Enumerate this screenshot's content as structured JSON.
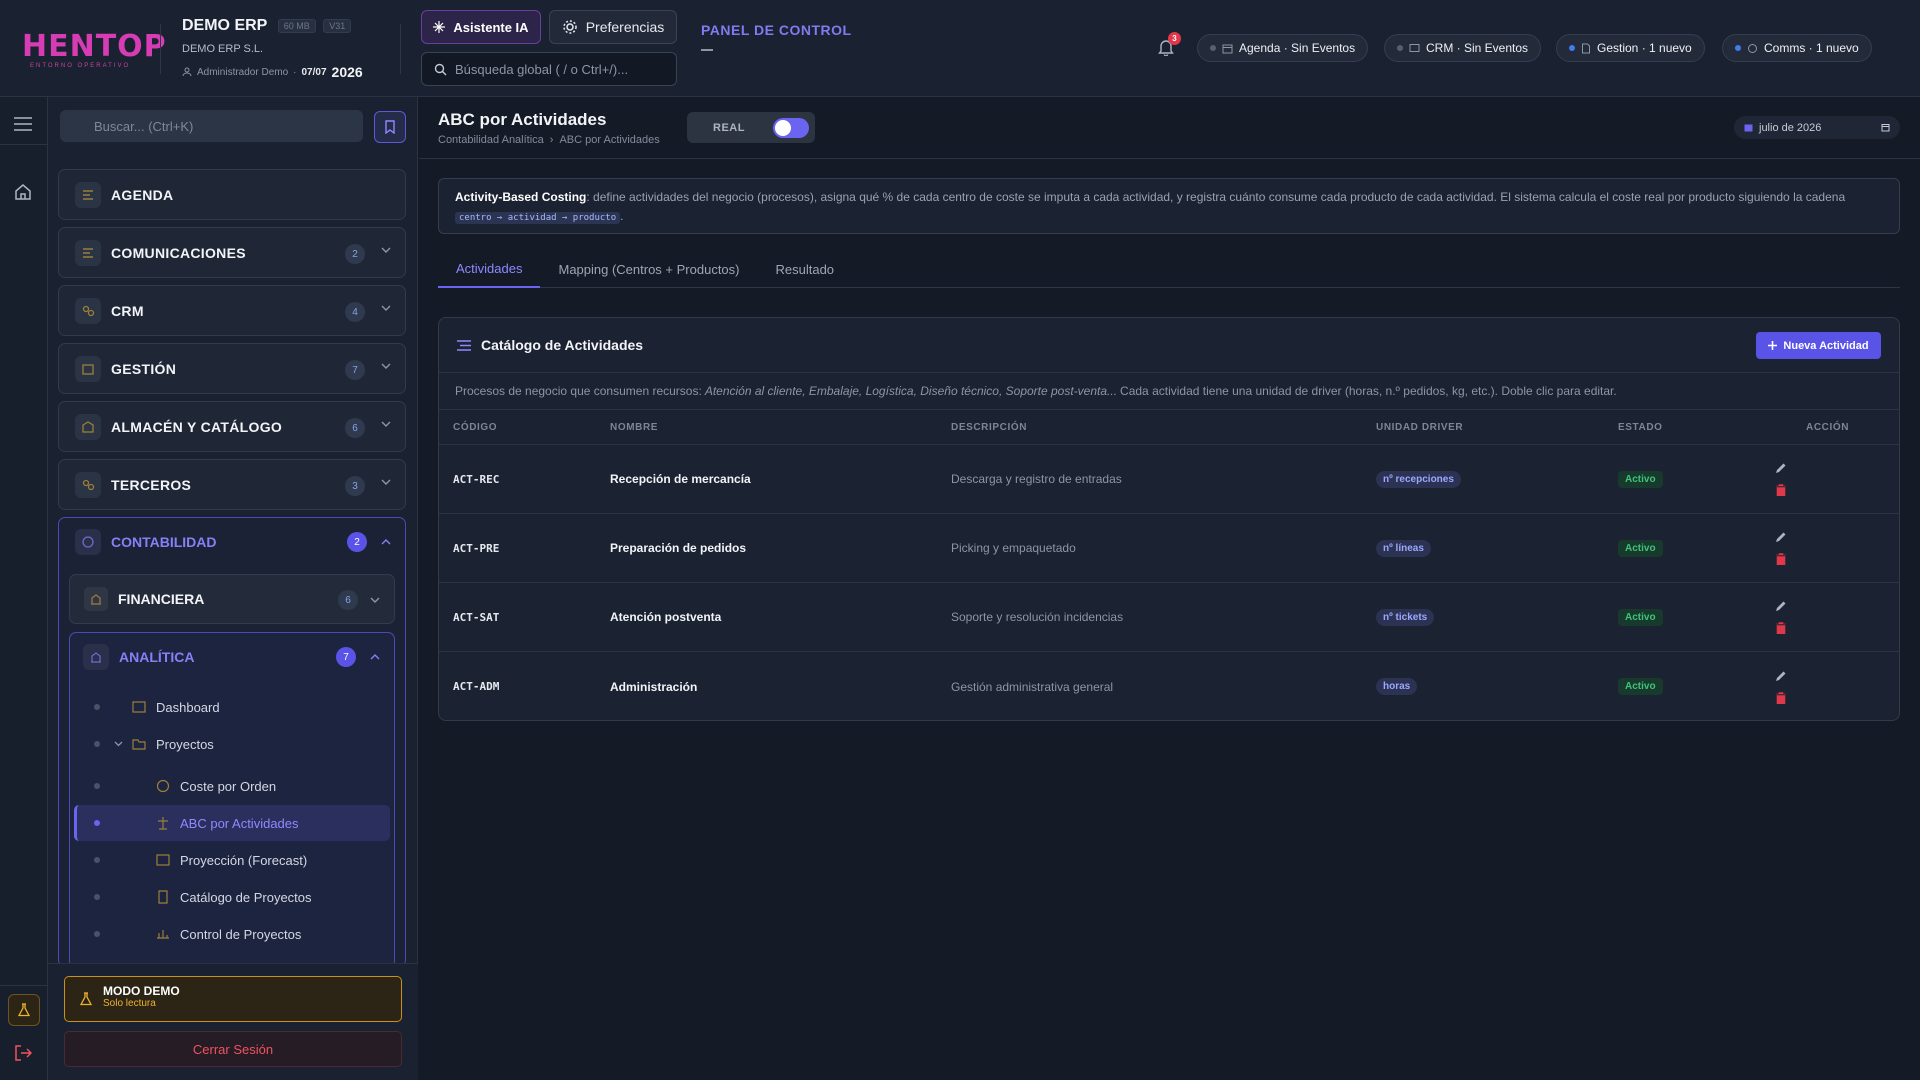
{
  "logo": {
    "text": "HENTOP",
    "subtitle": "ENTORNO OPERATIVO"
  },
  "company": {
    "name": "DEMO ERP",
    "mem_badge": "60 MB",
    "version_badge": "V31",
    "legal_name": "DEMO ERP S.L.",
    "user": "Administrador Demo",
    "date": "07/07",
    "year": "2026"
  },
  "header": {
    "ai_button": "Asistente IA",
    "prefs_button": "Preferencias",
    "search_placeholder": "Búsqueda global ( / o Ctrl+/)...",
    "panel_title": "PANEL DE CONTROL",
    "notif_count": "3"
  },
  "status_pills": [
    {
      "label": "Agenda · Sin Eventos",
      "active": false
    },
    {
      "label": "CRM · Sin Eventos",
      "active": false
    },
    {
      "label": "Gestion · 1 nuevo",
      "active": true
    },
    {
      "label": "Comms · 1 nuevo",
      "active": true
    }
  ],
  "sidebar": {
    "search_placeholder": "Buscar... (Ctrl+K)",
    "modules": [
      {
        "label": "AGENDA",
        "count": ""
      },
      {
        "label": "COMUNICACIONES",
        "count": "2"
      },
      {
        "label": "CRM",
        "count": "4"
      },
      {
        "label": "GESTIÓN",
        "count": "7"
      },
      {
        "label": "ALMACÉN Y CATÁLOGO",
        "count": "6"
      },
      {
        "label": "TERCEROS",
        "count": "3"
      }
    ],
    "open_module": {
      "label": "CONTABILIDAD",
      "count": "2"
    },
    "financiera": {
      "label": "FINANCIERA",
      "count": "6"
    },
    "analitica": {
      "label": "ANALÍTICA",
      "count": "7"
    },
    "tree": [
      {
        "label": "Dashboard"
      },
      {
        "label": "Proyectos"
      },
      {
        "label": "Coste por Orden"
      },
      {
        "label": "ABC por Actividades"
      },
      {
        "label": "Proyección (Forecast)"
      },
      {
        "label": "Catálogo de Proyectos"
      },
      {
        "label": "Control de Proyectos"
      }
    ],
    "demo_title": "MODO DEMO",
    "demo_sub": "Solo lectura",
    "logout": "Cerrar Sesión"
  },
  "page": {
    "title": "ABC por Actividades",
    "breadcrumb": [
      "Contabilidad Analítica",
      "ABC por Actividades"
    ],
    "toggle_label": "REAL",
    "date": "julio de 2026",
    "info_bold": "Activity-Based Costing",
    "info_text": ": define actividades del negocio (procesos), asigna qué % de cada centro de coste se imputa a cada actividad, y registra cuánto consume cada producto de cada actividad. El sistema calcula el coste real por producto siguiendo la cadena ",
    "info_code": "centro → actividad → producto",
    "info_end": ".",
    "tabs": [
      "Actividades",
      "Mapping (Centros + Productos)",
      "Resultado"
    ]
  },
  "card": {
    "title": "Catálogo de Actividades",
    "new_button": "Nueva Actividad",
    "desc_pre": "Procesos de negocio que consumen recursos:",
    "desc_italic": "Atención al cliente, Embalaje, Logística, Diseño técnico, Soporte post-venta...",
    "desc_post": "Cada actividad tiene una unidad de driver (horas, n.º pedidos, kg, etc.). Doble clic para editar.",
    "headers": [
      "CÓDIGO",
      "NOMBRE",
      "DESCRIPCIÓN",
      "UNIDAD DRIVER",
      "ESTADO",
      "ACCIÓN"
    ],
    "rows": [
      {
        "code": "ACT-REC",
        "name": "Recepción de mercancía",
        "desc": "Descarga y registro de entradas",
        "driver": "nº recepciones",
        "status": "Activo"
      },
      {
        "code": "ACT-PRE",
        "name": "Preparación de pedidos",
        "desc": "Picking y empaquetado",
        "driver": "nº líneas",
        "status": "Activo"
      },
      {
        "code": "ACT-SAT",
        "name": "Atención postventa",
        "desc": "Soporte y resolución incidencias",
        "driver": "nº tickets",
        "status": "Activo"
      },
      {
        "code": "ACT-ADM",
        "name": "Administración",
        "desc": "Gestión administrativa general",
        "driver": "horas",
        "status": "Activo"
      }
    ]
  },
  "colors": {
    "accent": "#6a64f0",
    "brand": "#d63cb4",
    "success": "#3ec37c",
    "danger": "#e0384a",
    "warning": "#f0b132"
  }
}
